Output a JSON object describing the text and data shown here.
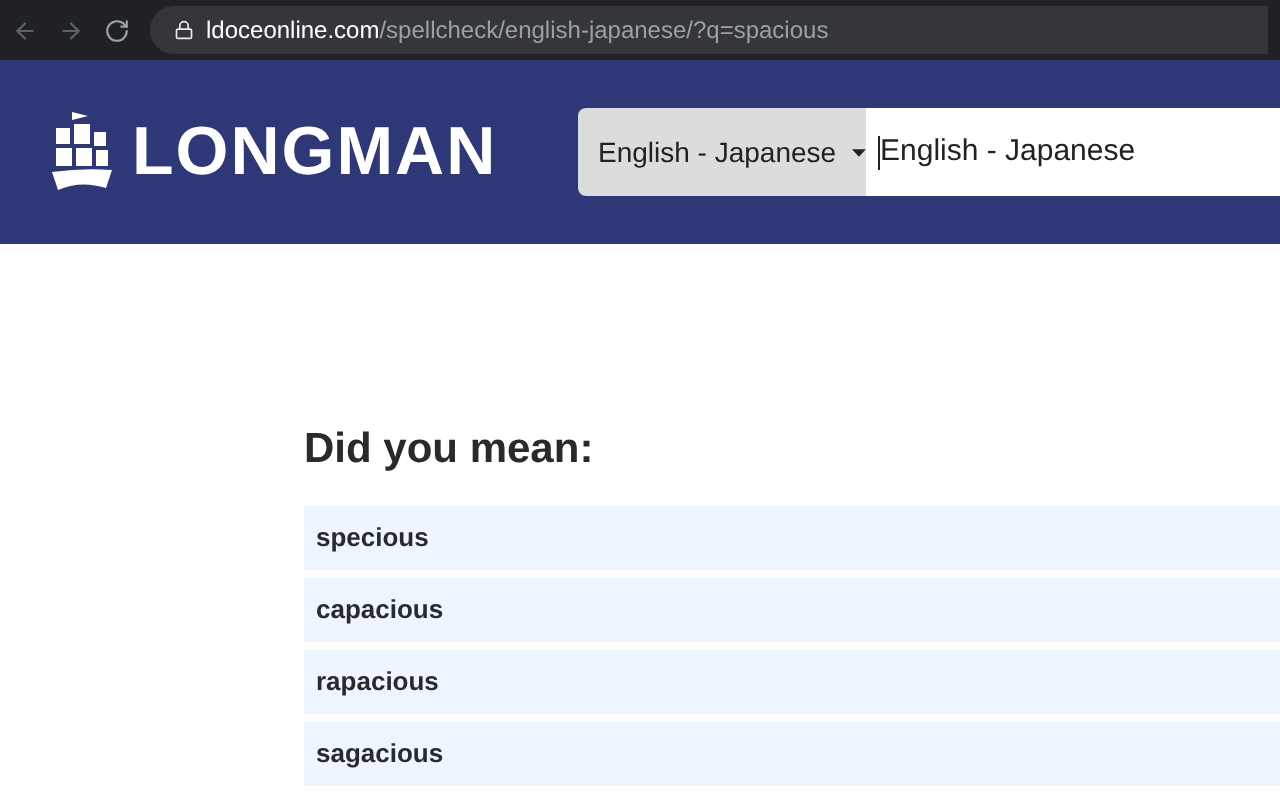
{
  "address_bar": {
    "host": "ldoceonline.com",
    "path": "/spellcheck/english-japanese/?q=spacious"
  },
  "header": {
    "logo_text": "LONGMAN",
    "dictionary_select": "English - Japanese",
    "search_value": "English - Japanese"
  },
  "suggestions": {
    "heading": "Did you mean:",
    "items": [
      "specious",
      "capacious",
      "rapacious",
      "sagacious"
    ]
  }
}
